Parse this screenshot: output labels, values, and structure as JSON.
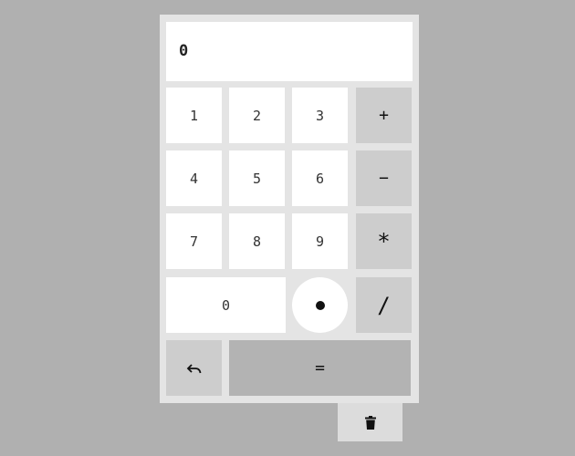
{
  "display": {
    "value": "0"
  },
  "keys": {
    "k1": "1",
    "k2": "2",
    "k3": "3",
    "k4": "4",
    "k5": "5",
    "k6": "6",
    "k7": "7",
    "k8": "8",
    "k9": "9",
    "k0": "0",
    "plus": "+",
    "minus": "−",
    "multiply": "*",
    "divide": "/",
    "equals": "="
  },
  "icons": {
    "dot": "decimal-point-icon",
    "undo": "undo-icon",
    "clear": "trash-icon"
  },
  "colors": {
    "background": "#b0b0b0",
    "panel": "#e4e4e4",
    "key": "#ffffff",
    "operator": "#cdcdcd",
    "equals": "#b3b3b3"
  }
}
